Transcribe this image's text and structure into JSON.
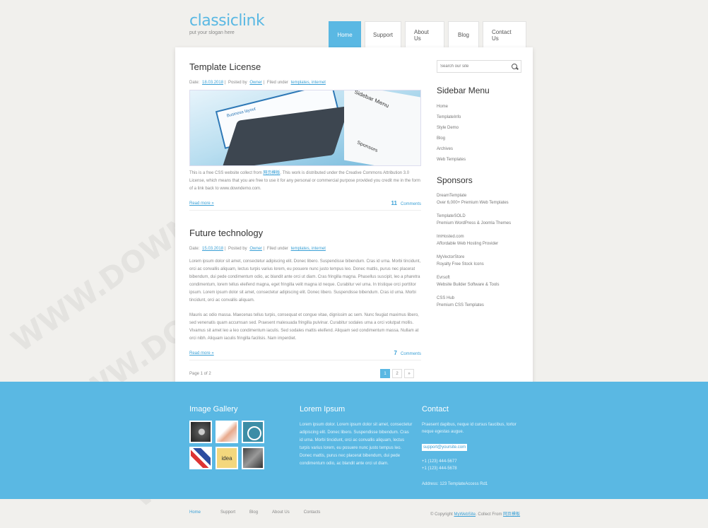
{
  "site": {
    "title": "classiclink",
    "slogan": "put your slogan here"
  },
  "nav": [
    "Home",
    "Support",
    "About Us",
    "Blog",
    "Contact Us"
  ],
  "posts": [
    {
      "title": "Template License",
      "date_label": "Date:",
      "date": "18.03.2018",
      "posted_label": "Posted by",
      "author": "Owner",
      "filed_label": "Filed under",
      "categories": "templates, internet",
      "image": {
        "side_title": "Sidebar Menu",
        "side_sub": "Sponsors",
        "screen_title": "Business layout"
      },
      "text_before": "This is a free CSS website collect from ",
      "text_link": "网页模板",
      "text_after": ". This work is distributed under the Creative Commons Attribution 3.0 License, which means that you are free to use it for any personal or commercial purpose provided you credit me in the form of a link back to www.downdemo.com.",
      "read_more": "Read more »",
      "comments_count": "11",
      "comments_label": "Comments"
    },
    {
      "title": "Future technology",
      "date_label": "Date:",
      "date": "15.03.2018",
      "posted_label": "Posted by",
      "author": "Owner",
      "filed_label": "Filed under",
      "categories": "templates, internet",
      "para1": "Lorem ipsum dolor sit amet, consectetur adipiscing elit. Donec libero. Suspendisse bibendum. Cras id urna. Morbi tincidunt, orci ac convallis aliquam, lectus turpis varius lorem, eu posuere nunc justo tempus leo. Donec mattis, purus nec placerat bibendum, dui pede condimentum odio, ac blandit ante orci ut diam. Cras fringilla magna. Phasellus suscipit, leo a pharetra condimentum, lorem tellus eleifend magna, eget fringilla velit magna id neque. Curabitur vel urna. In tristique orci porttitor ipsum. Lorem ipsum dolor sit amet, consectetur adipiscing elit. Donec libero. Suspendisse bibendum. Cras id urna. Morbi tincidunt, orci ac convallis aliquam.",
      "para2": "Mauris ac odio massa. Maecenas tellus turpis, consequat et congue vitae, dignissim ac sem. Nunc feugiat maximus libero, sed venenatis quam accumsan sed. Praesent malesuada fringilla pulvinar. Curabitur sodales urna a orci volutpat mollis. Vivamus sit amet leo a leo condimentum iaculis. Sed sodales mattis eleifend. Aliquam sed condimentum massa. Nullam at orci nibh. Aliquam iaculis fringilla facilisis. Nam imperdiet.",
      "read_more": "Read more »",
      "comments_count": "7",
      "comments_label": "Comments"
    }
  ],
  "pager": {
    "label": "Page 1 of 2",
    "pages": [
      "1",
      "2",
      "»"
    ]
  },
  "sidebar": {
    "search_placeholder": "Search our site",
    "menu_title": "Sidebar Menu",
    "menu": [
      "Home",
      "TemplateInfo",
      "Style Demo",
      "Blog",
      "Archives",
      "Web Templates"
    ],
    "sponsors_title": "Sponsors",
    "sponsors": [
      {
        "name": "DreamTemplate",
        "desc": "Over 6,000+ Premium Web Templates"
      },
      {
        "name": "TemplateSOLD",
        "desc": "Premium WordPress & Joomla Themes"
      },
      {
        "name": "ImHosted.com",
        "desc": "Affordable Web Hosting Provider"
      },
      {
        "name": "MyVectorStore",
        "desc": "Royalty Free Stock Icons"
      },
      {
        "name": "Evrsoft",
        "desc": "Website Builder Software & Tools"
      },
      {
        "name": "CSS Hub",
        "desc": "Premium CSS Templates"
      }
    ]
  },
  "footer": {
    "gallery_title": "Image Gallery",
    "gallery_thumb5": "idea",
    "lorem_title": "Lorem Ipsum",
    "lorem_text": "Lorem ipsum dolor. Lorem ipsum dolor sit amet, consectetur adipiscing elit. Donec libero. Suspendisse bibendum. Cras id urna. Morbi tincidunt, orci ac convallis aliquam, lectus turpis varius lorem, eu posuere nunc justo tempus leo. Donec mattis, purus nec placerat bibendum, dui pede condimentum odio, ac blandit ante orci ut diam.",
    "contact_title": "Contact",
    "contact_text": "Praesent dapibus, neque id cursus faucibus, tortor neque egestas augue.",
    "email": "support@yoursite.com",
    "phone1": "+1 (123) 444-5677",
    "phone2": "+1 (123) 444-5678",
    "address": "Address: 123 TemplateAccess Rd1"
  },
  "bottom": {
    "nav": [
      "Home",
      "Support",
      "Blog",
      "About Us",
      "Contacts"
    ],
    "copyright": "© Copyright",
    "copyright_link": "MyWebSite",
    "collect": ". Collect From",
    "collect_link": "网页模板"
  },
  "watermark": "WWW.DOWNDEMO.COM",
  "colors": {
    "accent": "#5ab8e3",
    "link": "#3aa0d6",
    "background": "#f1f0ed"
  }
}
